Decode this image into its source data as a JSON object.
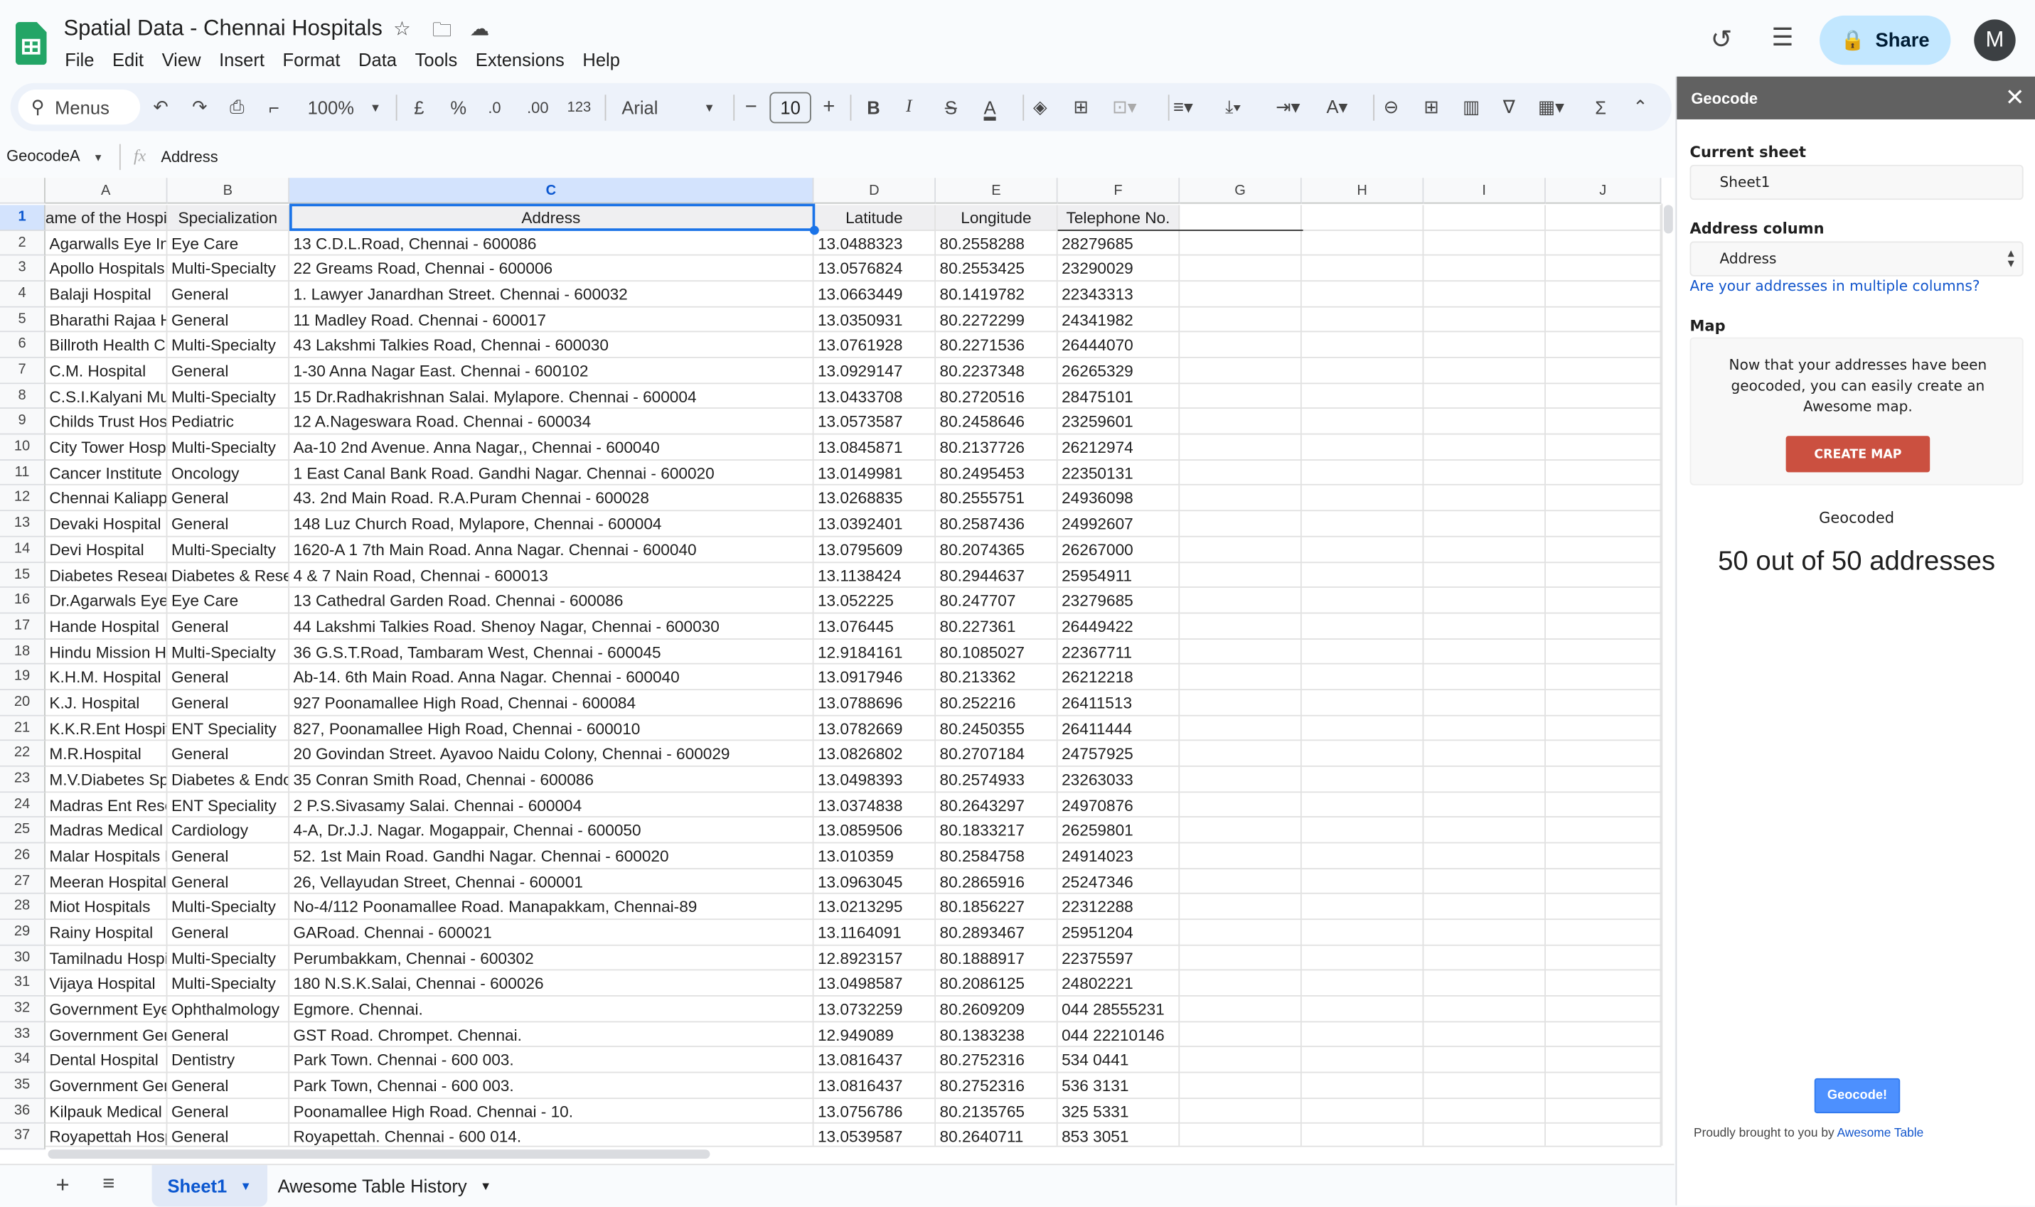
{
  "app": {
    "title": "Spatial Data - Chennai Hospitals",
    "menu": [
      "File",
      "Edit",
      "View",
      "Insert",
      "Format",
      "Data",
      "Tools",
      "Extensions",
      "Help"
    ],
    "share_label": "Share",
    "avatar_initial": "M"
  },
  "toolbar": {
    "search_label": "Menus",
    "zoom": "100%",
    "currency": "£",
    "percent": "%",
    "decrease_decimal": ".0",
    "increase_decimal": ".00",
    "number_format": "123",
    "font": "Arial",
    "font_size": "10"
  },
  "formula_bar": {
    "name_box": "GeocodeA",
    "fx": "fx",
    "value": "Address"
  },
  "sheet": {
    "columns": [
      "A",
      "B",
      "C",
      "D",
      "E",
      "F",
      "G",
      "H",
      "I",
      "J"
    ],
    "selected_column": "C",
    "headers": [
      "ame of the Hospit",
      "Specialization",
      "Address",
      "Latitude",
      "Longitude",
      "Telephone No."
    ],
    "rows": [
      [
        "Agarwalls Eye In",
        "Eye Care",
        "13 C.D.L.Road, Chennai - 600086",
        "13.0488323",
        "80.2558288",
        "28279685"
      ],
      [
        "Apollo Hospitals",
        "Multi-Specialty",
        "22 Greams Road, Chennai - 600006",
        "13.0576824",
        "80.2553425",
        "23290029"
      ],
      [
        "Balaji Hospital",
        "General",
        "1. Lawyer Janardhan Street. Chennai - 600032",
        "13.0663449",
        "80.1419782",
        "22343313"
      ],
      [
        "Bharathi Rajaa H",
        "General",
        "11 Madley Road. Chennai - 600017",
        "13.0350931",
        "80.2272299",
        "24341982"
      ],
      [
        "Billroth Health Ce",
        "Multi-Specialty",
        "43 Lakshmi Talkies Road, Chennai - 600030",
        "13.0761928",
        "80.2271536",
        "26444070"
      ],
      [
        "C.M. Hospital",
        "General",
        "1-30 Anna Nagar East. Chennai - 600102",
        "13.0929147",
        "80.2237348",
        "26265329"
      ],
      [
        "C.S.I.Kalyani Mu",
        "Multi-Specialty",
        "15 Dr.Radhakrishnan Salai. Mylapore. Chennai - 600004",
        "13.0433708",
        "80.2720516",
        "28475101"
      ],
      [
        "Childs Trust Hos",
        "Pediatric",
        "12 A.Nageswara Road. Chennai - 600034",
        "13.0573587",
        "80.2458646",
        "23259601"
      ],
      [
        "City Tower Hospi",
        "Multi-Specialty",
        "Aa-10 2nd Avenue. Anna Nagar,, Chennai - 600040",
        "13.0845871",
        "80.2137726",
        "26212974"
      ],
      [
        "Cancer Institute",
        "Oncology",
        "1 East Canal Bank Road. Gandhi Nagar. Chennai - 600020",
        "13.0149981",
        "80.2495453",
        "22350131"
      ],
      [
        "Chennai Kaliappa",
        "General",
        "43. 2nd Main Road. R.A.Puram Chennai - 600028",
        "13.0268835",
        "80.2555751",
        "24936098"
      ],
      [
        "Devaki Hospital",
        "General",
        "148 Luz Church Road, Mylapore, Chennai - 600004",
        "13.0392401",
        "80.2587436",
        "24992607"
      ],
      [
        "Devi Hospital",
        "Multi-Specialty",
        "1620-A 1 7th Main Road. Anna Nagar. Chennai - 600040",
        "13.0795609",
        "80.2074365",
        "26267000"
      ],
      [
        "Diabetes Resear",
        "Diabetes & Rese",
        "4 & 7 Nain Road, Chennai - 600013",
        "13.1138424",
        "80.2944637",
        "25954911"
      ],
      [
        "Dr.Agarwals Eye",
        "Eye Care",
        "13 Cathedral Garden Road. Chennai - 600086",
        "13.052225",
        "80.247707",
        "23279685"
      ],
      [
        "Hande Hospital",
        "General",
        "44 Lakshmi Talkies Road. Shenoy Nagar, Chennai - 600030",
        "13.076445",
        "80.227361",
        "26449422"
      ],
      [
        "Hindu Mission Ho",
        "Multi-Specialty",
        "36 G.S.T.Road, Tambaram West, Chennai - 600045",
        "12.9184161",
        "80.1085027",
        "22367711"
      ],
      [
        "K.H.M. Hospital",
        "General",
        "Ab-14. 6th Main Road. Anna Nagar. Chennai - 600040",
        "13.0917946",
        "80.213362",
        "26212218"
      ],
      [
        "K.J. Hospital",
        "General",
        "927 Poonamallee High Road, Chennai - 600084",
        "13.0788696",
        "80.252216",
        "26411513"
      ],
      [
        "K.K.R.Ent Hospit",
        "ENT Speciality",
        "827, Poonamallee High Road, Chennai - 600010",
        "13.0782669",
        "80.2450355",
        "26411444"
      ],
      [
        "M.R.Hospital",
        "General",
        "20 Govindan Street. Ayavoo Naidu Colony, Chennai - 600029",
        "13.0826802",
        "80.2707184",
        "24757925"
      ],
      [
        "M.V.Diabetes Sp",
        "Diabetes & Endo",
        "35 Conran Smith Road, Chennai - 600086",
        "13.0498393",
        "80.2574933",
        "23263033"
      ],
      [
        "Madras Ent Rese",
        "ENT Speciality",
        "2 P.S.Sivasamy Salai. Chennai - 600004",
        "13.0374838",
        "80.2643297",
        "24970876"
      ],
      [
        "Madras Medical I",
        "Cardiology",
        "4-A, Dr.J.J. Nagar. Mogappair, Chennai - 600050",
        "13.0859506",
        "80.1833217",
        "26259801"
      ],
      [
        "Malar Hospitals L",
        "General",
        "52. 1st Main Road. Gandhi Nagar. Chennai - 600020",
        "13.010359",
        "80.2584758",
        "24914023"
      ],
      [
        "Meeran Hospital",
        "General",
        "26, Vellayudan Street, Chennai - 600001",
        "13.0963045",
        "80.2865916",
        "25247346"
      ],
      [
        "Miot Hospitals",
        "Multi-Specialty",
        "No-4/112 Poonamallee Road. Manapakkam, Chennai-89",
        "13.0213295",
        "80.1856227",
        "22312288"
      ],
      [
        "Rainy Hospital",
        "General",
        "GARoad. Chennai - 600021",
        "13.1164091",
        "80.2893467",
        "25951204"
      ],
      [
        "Tamilnadu Hospi",
        "Multi-Specialty",
        "Perumbakkam, Chennai - 600302",
        "12.8923157",
        "80.1888917",
        "22375597"
      ],
      [
        "Vijaya Hospital",
        "Multi-Specialty",
        "180 N.S.K.Salai, Chennai - 600026",
        "13.0498587",
        "80.2086125",
        "24802221"
      ],
      [
        "Government Eye",
        "Ophthalmology",
        "Egmore. Chennai.",
        "13.0732259",
        "80.2609209",
        "044 28555231"
      ],
      [
        "Government Gen",
        "General",
        "GST Road. Chrompet. Chennai.",
        "12.949089",
        "80.1383238",
        "044 22210146"
      ],
      [
        "Dental Hospital",
        "Dentistry",
        "Park Town. Chennai - 600 003.",
        "13.0816437",
        "80.2752316",
        "534 0441"
      ],
      [
        "Government Gen",
        "General",
        "Park Town, Chennai - 600 003.",
        "13.0816437",
        "80.2752316",
        "536 3131"
      ],
      [
        "Kilpauk Medical (",
        "General",
        "Poonamallee High Road. Chennai - 10.",
        "13.0756786",
        "80.2135765",
        "325 5331"
      ],
      [
        "Royapettah Hosp",
        "General",
        "Royapettah. Chennai - 600 014.",
        "13.0539587",
        "80.2640711",
        "853 3051"
      ]
    ]
  },
  "tabs": [
    {
      "label": "Sheet1",
      "active": true
    },
    {
      "label": "Awesome Table History",
      "active": false
    }
  ],
  "sidebar": {
    "title": "Geocode",
    "current_sheet_label": "Current sheet",
    "current_sheet_value": "Sheet1",
    "address_column_label": "Address column",
    "address_column_value": "Address",
    "multiple_columns_link": "Are your addresses in multiple columns?",
    "map_label": "Map",
    "map_text": "Now that your addresses have been geocoded, you can easily create an Awesome map.",
    "create_map_label": "CREATE MAP",
    "geocoded_label": "Geocoded",
    "geocoded_count": "50 out of 50 addresses",
    "geocode_button": "Geocode!",
    "footer_text": "Proudly brought to you by",
    "footer_link": "Awesome Table"
  },
  "colors": {
    "accent": "#1a73e8",
    "create_map": "#cb5040",
    "geocode_button": "#4d90fe",
    "sidebar_header": "#616161",
    "sheets_green": "#23a566"
  }
}
